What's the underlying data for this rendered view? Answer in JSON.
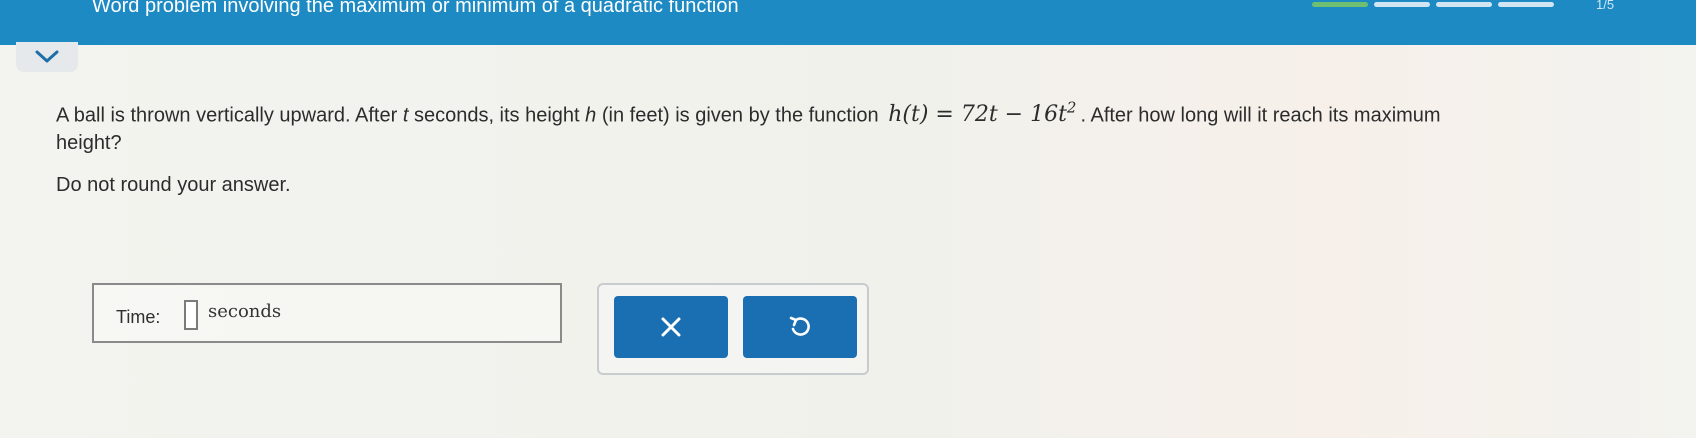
{
  "header": {
    "title": "Word problem involving the maximum or minimum of a quadratic function",
    "progress": {
      "segments": [
        1,
        0,
        0,
        0
      ],
      "count_text": "1/5"
    }
  },
  "question": {
    "line1_start": "A ball is thrown vertically upward. After ",
    "var_t": "t",
    "line1_mid": " seconds, its height ",
    "var_h": "h",
    "line1_mid2": " (in feet) is given by the function ",
    "formula_main": "h(t) = 72t − 16t",
    "formula_exponent": "2",
    "line1_end": ". After how long will it reach its maximum",
    "line2": "height?"
  },
  "instruction": "Do not round your answer.",
  "answer": {
    "label": "Time:",
    "value": "",
    "units": "seconds"
  },
  "buttons": {
    "clear_icon": "x-icon",
    "undo_icon": "undo-icon"
  },
  "colors": {
    "header_blue": "#1e8ac4",
    "button_blue": "#1a6fb3",
    "progress_green": "#6fbf73"
  }
}
